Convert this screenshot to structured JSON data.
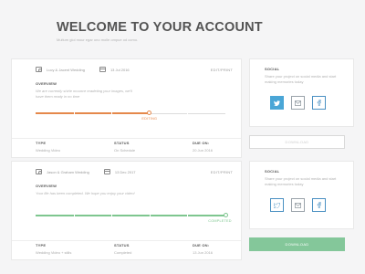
{
  "header": {
    "title": "WELCOME TO YOUR ACCOUNT",
    "subtitle": "Multum gloi mour egar ono molle ompue od ocmo."
  },
  "colors": {
    "editing": "#e5884b",
    "completed": "#7ec68f",
    "social_blue": "#4aa6d6"
  },
  "orders": [
    {
      "name": "Lucy & Jacent Wedding",
      "date": "13 Jul 2016",
      "edit_print": "EDIT/PRINT",
      "overview_label": "OVERVIEW",
      "overview_text": "We are currently shirle mounce eradeting your images, we'll have them ready in no time",
      "stage_label": "EDITING",
      "progress": 0.6,
      "type_label": "TYPE",
      "type_value": "Wedding Video",
      "status_label": "STATUS",
      "status_value": "On Schedule",
      "due_label": "DUE ON:",
      "due_value": "20 Jun 2016",
      "social_title": "SOCIAL",
      "social_text": "Share your project on social media and start making memories today",
      "download_label": "DOWNLOAD"
    },
    {
      "name": "Jason & Graham Wedding",
      "date": "13 Dec 2017",
      "edit_print": "EDIT/PRINT",
      "overview_label": "OVERVIEW",
      "overview_text": "Your file has been completed. We hope you enjoy your video!",
      "stage_label": "COMPLETED",
      "progress": 1.0,
      "type_label": "TYPE",
      "type_value": "Wedding Video + stills",
      "status_label": "STATUS",
      "status_value": "Completed",
      "due_label": "DUE ON:",
      "due_value": "13 Jun 2016",
      "social_title": "SOCIAL",
      "social_text": "Share your project on social media and start making memories today",
      "download_label": "DOWNLOAD"
    }
  ]
}
